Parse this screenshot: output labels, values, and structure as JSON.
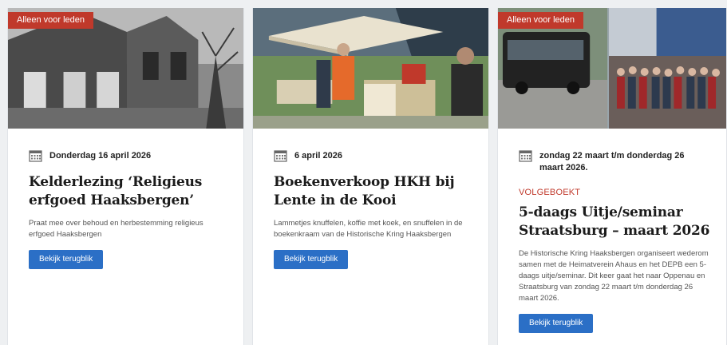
{
  "cards": [
    {
      "badge": "Alleen voor leden",
      "date": "Donderdag 16 april 2026",
      "tag": "",
      "title": "Kelderlezing ‘Religieus erfgoed Haaksbergen’",
      "description": "Praat mee over behoud en herbestemming religieus erfgoed Haaksbergen",
      "button": "Bekijk terugblik"
    },
    {
      "badge": "",
      "date": "6 april 2026",
      "tag": "",
      "title": "Boekenverkoop HKH bij Lente in de Kooi",
      "description": "Lammetjes knuffelen, koffie met koek, en snuffelen in de boekenkraam van de Historische Kring Haaksbergen",
      "button": "Bekijk terugblik"
    },
    {
      "badge": "Alleen voor leden",
      "date": "zondag 22 maart t/m donderdag 26 maart 2026.",
      "tag": "VOLGEBOEKT",
      "title": "5-daags Uitje/seminar Straatsburg – maart 2026",
      "description": "De Historische Kring Haaksbergen organiseert wederom samen met de Heimatverein Ahaus en het DEPB een 5-daags uitje/seminar. Dit keer gaat het naar Oppenau en Straatsburg van zondag 22 maart t/m donderdag 26 maart 2026.",
      "button": "Bekijk terugblik"
    }
  ],
  "colors": {
    "badge": "#c0392b",
    "button": "#2b6fc6",
    "tag": "#c0392b"
  },
  "icons": {
    "date": "calendar-icon"
  }
}
